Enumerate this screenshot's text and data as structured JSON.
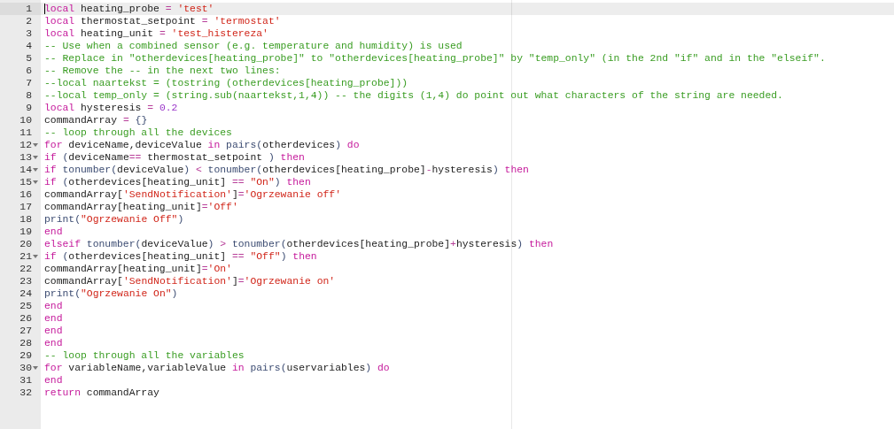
{
  "editor": {
    "lines": [
      {
        "number": "1",
        "active": true,
        "foldable": false,
        "tokens": [
          {
            "kind": "kw",
            "text": "local"
          },
          {
            "kind": "id",
            "text": " heating_probe "
          },
          {
            "kind": "op",
            "text": "= "
          },
          {
            "kind": "str",
            "text": "'test'"
          }
        ]
      },
      {
        "number": "2",
        "active": false,
        "foldable": false,
        "tokens": [
          {
            "kind": "kw",
            "text": "local"
          },
          {
            "kind": "id",
            "text": " thermostat_setpoint "
          },
          {
            "kind": "op",
            "text": "= "
          },
          {
            "kind": "str",
            "text": "'termostat'"
          }
        ]
      },
      {
        "number": "3",
        "active": false,
        "foldable": false,
        "tokens": [
          {
            "kind": "kw",
            "text": "local"
          },
          {
            "kind": "id",
            "text": " heating_unit "
          },
          {
            "kind": "op",
            "text": "= "
          },
          {
            "kind": "str",
            "text": "'test_histereza'"
          }
        ]
      },
      {
        "number": "4",
        "active": false,
        "foldable": false,
        "tokens": [
          {
            "kind": "com",
            "text": "-- Use when a combined sensor (e.g. temperature and humidity) is used"
          }
        ]
      },
      {
        "number": "5",
        "active": false,
        "foldable": false,
        "tokens": [
          {
            "kind": "com",
            "text": "-- Replace in \"otherdevices[heating_probe]\" to \"otherdevices[heating_probe]\" by \"temp_only\" (in the 2nd \"if\" and in the \"elseif\"."
          }
        ]
      },
      {
        "number": "6",
        "active": false,
        "foldable": false,
        "tokens": [
          {
            "kind": "com",
            "text": "-- Remove the -- in the next two lines:"
          }
        ]
      },
      {
        "number": "7",
        "active": false,
        "foldable": false,
        "tokens": [
          {
            "kind": "com",
            "text": "--local naartekst = (tostring (otherdevices[heating_probe]))"
          }
        ]
      },
      {
        "number": "8",
        "active": false,
        "foldable": false,
        "tokens": [
          {
            "kind": "com",
            "text": "--local temp_only = (string.sub(naartekst,1,4)) -- the digits (1,4) do point out what characters of the string are needed."
          }
        ]
      },
      {
        "number": "9",
        "active": false,
        "foldable": false,
        "tokens": [
          {
            "kind": "kw",
            "text": "local"
          },
          {
            "kind": "id",
            "text": " hysteresis "
          },
          {
            "kind": "op",
            "text": "= "
          },
          {
            "kind": "num",
            "text": "0.2"
          }
        ]
      },
      {
        "number": "10",
        "active": false,
        "foldable": false,
        "tokens": [
          {
            "kind": "id",
            "text": "commandArray "
          },
          {
            "kind": "op",
            "text": "= "
          },
          {
            "kind": "paren",
            "text": "{}"
          }
        ]
      },
      {
        "number": "11",
        "active": false,
        "foldable": false,
        "tokens": [
          {
            "kind": "com",
            "text": "-- loop through all the devices"
          }
        ]
      },
      {
        "number": "12",
        "active": false,
        "foldable": true,
        "tokens": [
          {
            "kind": "kw",
            "text": "for"
          },
          {
            "kind": "id",
            "text": " deviceName,deviceValue "
          },
          {
            "kind": "kw",
            "text": "in "
          },
          {
            "kind": "fn",
            "text": "pairs"
          },
          {
            "kind": "paren",
            "text": "("
          },
          {
            "kind": "id",
            "text": "otherdevices"
          },
          {
            "kind": "paren",
            "text": ") "
          },
          {
            "kind": "kw",
            "text": "do"
          }
        ]
      },
      {
        "number": "13",
        "active": false,
        "foldable": true,
        "tokens": [
          {
            "kind": "kw",
            "text": "if "
          },
          {
            "kind": "paren",
            "text": "("
          },
          {
            "kind": "id",
            "text": "deviceName"
          },
          {
            "kind": "op",
            "text": "=="
          },
          {
            "kind": "id",
            "text": " thermostat_setpoint "
          },
          {
            "kind": "paren",
            "text": ") "
          },
          {
            "kind": "kw",
            "text": "then"
          }
        ]
      },
      {
        "number": "14",
        "active": false,
        "foldable": true,
        "tokens": [
          {
            "kind": "kw",
            "text": "if "
          },
          {
            "kind": "fn",
            "text": "tonumber"
          },
          {
            "kind": "paren",
            "text": "("
          },
          {
            "kind": "id",
            "text": "deviceValue"
          },
          {
            "kind": "paren",
            "text": ") "
          },
          {
            "kind": "op",
            "text": "< "
          },
          {
            "kind": "fn",
            "text": "tonumber"
          },
          {
            "kind": "paren",
            "text": "("
          },
          {
            "kind": "id",
            "text": "otherdevices[heating_probe]"
          },
          {
            "kind": "op",
            "text": "-"
          },
          {
            "kind": "id",
            "text": "hysteresis"
          },
          {
            "kind": "paren",
            "text": ") "
          },
          {
            "kind": "kw",
            "text": "then"
          }
        ]
      },
      {
        "number": "15",
        "active": false,
        "foldable": true,
        "tokens": [
          {
            "kind": "kw",
            "text": "if "
          },
          {
            "kind": "paren",
            "text": "("
          },
          {
            "kind": "id",
            "text": "otherdevices[heating_unit] "
          },
          {
            "kind": "op",
            "text": "== "
          },
          {
            "kind": "str",
            "text": "\"On\""
          },
          {
            "kind": "paren",
            "text": ") "
          },
          {
            "kind": "kw",
            "text": "then"
          }
        ]
      },
      {
        "number": "16",
        "active": false,
        "foldable": false,
        "tokens": [
          {
            "kind": "id",
            "text": "commandArray["
          },
          {
            "kind": "str",
            "text": "'SendNotification'"
          },
          {
            "kind": "id",
            "text": "]"
          },
          {
            "kind": "op",
            "text": "="
          },
          {
            "kind": "str",
            "text": "'Ogrzewanie off'"
          }
        ]
      },
      {
        "number": "17",
        "active": false,
        "foldable": false,
        "tokens": [
          {
            "kind": "id",
            "text": "commandArray[heating_unit]"
          },
          {
            "kind": "op",
            "text": "="
          },
          {
            "kind": "str",
            "text": "'Off'"
          }
        ]
      },
      {
        "number": "18",
        "active": false,
        "foldable": false,
        "tokens": [
          {
            "kind": "fn",
            "text": "print"
          },
          {
            "kind": "paren",
            "text": "("
          },
          {
            "kind": "str",
            "text": "\"Ogrzewanie Off\""
          },
          {
            "kind": "paren",
            "text": ")"
          }
        ]
      },
      {
        "number": "19",
        "active": false,
        "foldable": false,
        "tokens": [
          {
            "kind": "kw",
            "text": "end"
          }
        ]
      },
      {
        "number": "20",
        "active": false,
        "foldable": false,
        "tokens": [
          {
            "kind": "kw",
            "text": "elseif "
          },
          {
            "kind": "fn",
            "text": "tonumber"
          },
          {
            "kind": "paren",
            "text": "("
          },
          {
            "kind": "id",
            "text": "deviceValue"
          },
          {
            "kind": "paren",
            "text": ") "
          },
          {
            "kind": "op",
            "text": "> "
          },
          {
            "kind": "fn",
            "text": "tonumber"
          },
          {
            "kind": "paren",
            "text": "("
          },
          {
            "kind": "id",
            "text": "otherdevices[heating_probe]"
          },
          {
            "kind": "op",
            "text": "+"
          },
          {
            "kind": "id",
            "text": "hysteresis"
          },
          {
            "kind": "paren",
            "text": ") "
          },
          {
            "kind": "kw",
            "text": "then"
          }
        ]
      },
      {
        "number": "21",
        "active": false,
        "foldable": true,
        "tokens": [
          {
            "kind": "kw",
            "text": "if "
          },
          {
            "kind": "paren",
            "text": "("
          },
          {
            "kind": "id",
            "text": "otherdevices[heating_unit] "
          },
          {
            "kind": "op",
            "text": "== "
          },
          {
            "kind": "str",
            "text": "\"Off\""
          },
          {
            "kind": "paren",
            "text": ") "
          },
          {
            "kind": "kw",
            "text": "then"
          }
        ]
      },
      {
        "number": "22",
        "active": false,
        "foldable": false,
        "tokens": [
          {
            "kind": "id",
            "text": "commandArray[heating_unit]"
          },
          {
            "kind": "op",
            "text": "="
          },
          {
            "kind": "str",
            "text": "'On'"
          }
        ]
      },
      {
        "number": "23",
        "active": false,
        "foldable": false,
        "tokens": [
          {
            "kind": "id",
            "text": "commandArray["
          },
          {
            "kind": "str",
            "text": "'SendNotification'"
          },
          {
            "kind": "id",
            "text": "]"
          },
          {
            "kind": "op",
            "text": "="
          },
          {
            "kind": "str",
            "text": "'Ogrzewanie on'"
          }
        ]
      },
      {
        "number": "24",
        "active": false,
        "foldable": false,
        "tokens": [
          {
            "kind": "fn",
            "text": "print"
          },
          {
            "kind": "paren",
            "text": "("
          },
          {
            "kind": "str",
            "text": "\"Ogrzewanie On\""
          },
          {
            "kind": "paren",
            "text": ")"
          }
        ]
      },
      {
        "number": "25",
        "active": false,
        "foldable": false,
        "tokens": [
          {
            "kind": "kw",
            "text": "end"
          }
        ]
      },
      {
        "number": "26",
        "active": false,
        "foldable": false,
        "tokens": [
          {
            "kind": "kw",
            "text": "end"
          }
        ]
      },
      {
        "number": "27",
        "active": false,
        "foldable": false,
        "tokens": [
          {
            "kind": "kw",
            "text": "end"
          }
        ]
      },
      {
        "number": "28",
        "active": false,
        "foldable": false,
        "tokens": [
          {
            "kind": "kw",
            "text": "end"
          }
        ]
      },
      {
        "number": "29",
        "active": false,
        "foldable": false,
        "tokens": [
          {
            "kind": "com",
            "text": "-- loop through all the variables"
          }
        ]
      },
      {
        "number": "30",
        "active": false,
        "foldable": true,
        "tokens": [
          {
            "kind": "kw",
            "text": "for"
          },
          {
            "kind": "id",
            "text": " variableName,variableValue "
          },
          {
            "kind": "kw",
            "text": "in "
          },
          {
            "kind": "fn",
            "text": "pairs"
          },
          {
            "kind": "paren",
            "text": "("
          },
          {
            "kind": "id",
            "text": "uservariables"
          },
          {
            "kind": "paren",
            "text": ") "
          },
          {
            "kind": "kw",
            "text": "do"
          }
        ]
      },
      {
        "number": "31",
        "active": false,
        "foldable": false,
        "tokens": [
          {
            "kind": "kw",
            "text": "end"
          }
        ]
      },
      {
        "number": "32",
        "active": false,
        "foldable": false,
        "tokens": [
          {
            "kind": "kw",
            "text": "return"
          },
          {
            "kind": "id",
            "text": " commandArray"
          }
        ]
      }
    ]
  }
}
